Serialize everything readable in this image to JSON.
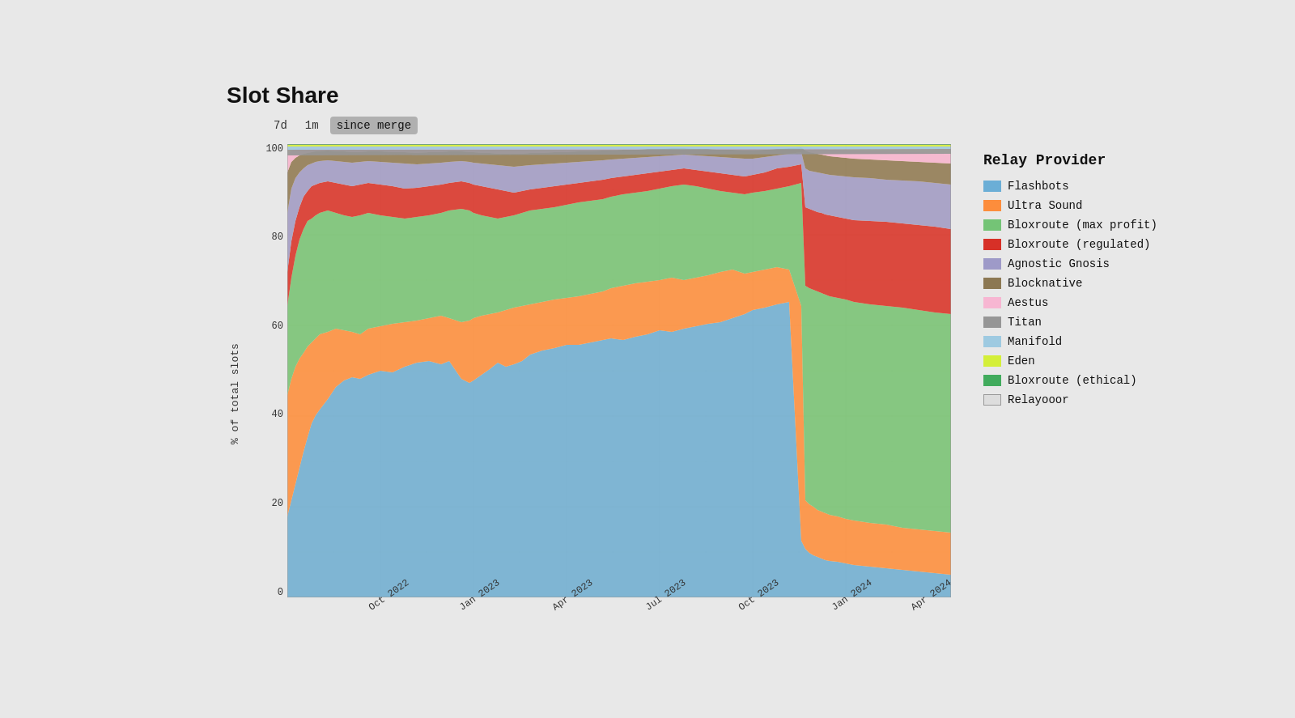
{
  "title": "Slot Share",
  "timeControls": {
    "options": [
      "7d",
      "1m",
      "since merge"
    ],
    "active": "since merge"
  },
  "yAxis": {
    "label": "% of total slots",
    "ticks": [
      "0",
      "20",
      "40",
      "60",
      "80",
      "100"
    ]
  },
  "xAxis": {
    "ticks": [
      "Oct 2022",
      "Jan 2023",
      "Apr 2023",
      "Jul 2023",
      "Oct 2023",
      "Jan 2024",
      "Apr 2024"
    ]
  },
  "legend": {
    "title": "Relay Provider",
    "items": [
      {
        "label": "Flashbots",
        "color": "#6baed6"
      },
      {
        "label": "Ultra Sound",
        "color": "#fd8d3c"
      },
      {
        "label": "Bloxroute (max profit)",
        "color": "#74c476"
      },
      {
        "label": "Bloxroute (regulated)",
        "color": "#d73027"
      },
      {
        "label": "Agnostic Gnosis",
        "color": "#9e9ac8"
      },
      {
        "label": "Blocknative",
        "color": "#8c7853"
      },
      {
        "label": "Aestus",
        "color": "#f7b6d2"
      },
      {
        "label": "Titan",
        "color": "#969696"
      },
      {
        "label": "Manifold",
        "color": "#9ecae1"
      },
      {
        "label": "Eden",
        "color": "#d4ef39"
      },
      {
        "label": "Bloxroute (ethical)",
        "color": "#41ab5d"
      },
      {
        "label": "Relayooor",
        "color": "#ffffff"
      }
    ]
  }
}
